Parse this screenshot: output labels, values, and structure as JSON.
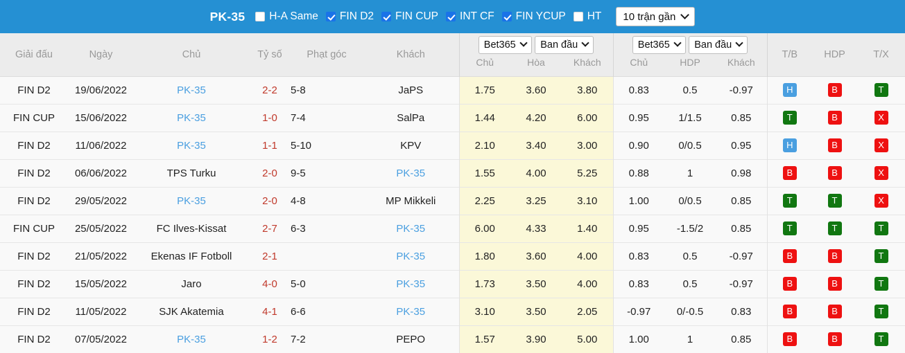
{
  "topbar": {
    "team": "PK-35",
    "filters": [
      {
        "label": "H-A Same",
        "checked": false
      },
      {
        "label": "FIN D2",
        "checked": true
      },
      {
        "label": "FIN CUP",
        "checked": true
      },
      {
        "label": "INT CF",
        "checked": true
      },
      {
        "label": "FIN YCUP",
        "checked": true
      },
      {
        "label": "HT",
        "checked": false
      }
    ],
    "range_select": "10 trận gần",
    "accent_color": "#2590d3",
    "checkbox_on_color": "#1a73e8"
  },
  "table": {
    "headers": {
      "league": "Giải đấu",
      "date": "Ngày",
      "home": "Chủ",
      "score": "Tỷ số",
      "corners": "Phạt góc",
      "away": "Khách",
      "group1_book": "Bet365",
      "group1_type": "Ban đầu",
      "group1_sub": [
        "Chủ",
        "Hòa",
        "Khách"
      ],
      "group2_book": "Bet365",
      "group2_type": "Ban đầu",
      "group2_sub": [
        "Chủ",
        "HDP",
        "Khách"
      ],
      "tb": "T/B",
      "hdp": "HDP",
      "tx": "T/X"
    },
    "rows": [
      {
        "league": "FIN D2",
        "date": "19/06/2022",
        "home": "PK-35",
        "home_hl": true,
        "score": "2-2",
        "corners": "5-8",
        "away": "JaPS",
        "away_hl": false,
        "o1": "1.75",
        "o2": "3.60",
        "o3": "3.80",
        "a1": "0.83",
        "a2": "0.5",
        "a3": "-0.97",
        "tb": "H",
        "hdp": "B",
        "tx": "T"
      },
      {
        "league": "FIN CUP",
        "date": "15/06/2022",
        "home": "PK-35",
        "home_hl": true,
        "score": "1-0",
        "corners": "7-4",
        "away": "SalPa",
        "away_hl": false,
        "o1": "1.44",
        "o2": "4.20",
        "o3": "6.00",
        "a1": "0.95",
        "a2": "1/1.5",
        "a3": "0.85",
        "tb": "T",
        "hdp": "B",
        "tx": "X"
      },
      {
        "league": "FIN D2",
        "date": "11/06/2022",
        "home": "PK-35",
        "home_hl": true,
        "score": "1-1",
        "corners": "5-10",
        "away": "KPV",
        "away_hl": false,
        "o1": "2.10",
        "o2": "3.40",
        "o3": "3.00",
        "a1": "0.90",
        "a2": "0/0.5",
        "a3": "0.95",
        "tb": "H",
        "hdp": "B",
        "tx": "X"
      },
      {
        "league": "FIN D2",
        "date": "06/06/2022",
        "home": "TPS Turku",
        "home_hl": false,
        "score": "2-0",
        "corners": "9-5",
        "away": "PK-35",
        "away_hl": true,
        "o1": "1.55",
        "o2": "4.00",
        "o3": "5.25",
        "a1": "0.88",
        "a2": "1",
        "a3": "0.98",
        "tb": "B",
        "hdp": "B",
        "tx": "X"
      },
      {
        "league": "FIN D2",
        "date": "29/05/2022",
        "home": "PK-35",
        "home_hl": true,
        "score": "2-0",
        "corners": "4-8",
        "away": "MP Mikkeli",
        "away_hl": false,
        "o1": "2.25",
        "o2": "3.25",
        "o3": "3.10",
        "a1": "1.00",
        "a2": "0/0.5",
        "a3": "0.85",
        "tb": "T",
        "hdp": "T",
        "tx": "X"
      },
      {
        "league": "FIN CUP",
        "date": "25/05/2022",
        "home": "FC Ilves-Kissat",
        "home_hl": false,
        "score": "2-7",
        "corners": "6-3",
        "away": "PK-35",
        "away_hl": true,
        "o1": "6.00",
        "o2": "4.33",
        "o3": "1.40",
        "a1": "0.95",
        "a2": "-1.5/2",
        "a3": "0.85",
        "tb": "T",
        "hdp": "T",
        "tx": "T"
      },
      {
        "league": "FIN D2",
        "date": "21/05/2022",
        "home": "Ekenas IF Fotboll",
        "home_hl": false,
        "score": "2-1",
        "corners": "",
        "away": "PK-35",
        "away_hl": true,
        "o1": "1.80",
        "o2": "3.60",
        "o3": "4.00",
        "a1": "0.83",
        "a2": "0.5",
        "a3": "-0.97",
        "tb": "B",
        "hdp": "B",
        "tx": "T"
      },
      {
        "league": "FIN D2",
        "date": "15/05/2022",
        "home": "Jaro",
        "home_hl": false,
        "score": "4-0",
        "corners": "5-0",
        "away": "PK-35",
        "away_hl": true,
        "o1": "1.73",
        "o2": "3.50",
        "o3": "4.00",
        "a1": "0.83",
        "a2": "0.5",
        "a3": "-0.97",
        "tb": "B",
        "hdp": "B",
        "tx": "T"
      },
      {
        "league": "FIN D2",
        "date": "11/05/2022",
        "home": "SJK Akatemia",
        "home_hl": false,
        "score": "4-1",
        "corners": "6-6",
        "away": "PK-35",
        "away_hl": true,
        "o1": "3.10",
        "o2": "3.50",
        "o3": "2.05",
        "a1": "-0.97",
        "a2": "0/-0.5",
        "a3": "0.83",
        "tb": "B",
        "hdp": "B",
        "tx": "T"
      },
      {
        "league": "FIN D2",
        "date": "07/05/2022",
        "home": "PK-35",
        "home_hl": true,
        "score": "1-2",
        "corners": "7-2",
        "away": "PEPO",
        "away_hl": false,
        "o1": "1.57",
        "o2": "3.90",
        "o3": "5.00",
        "a1": "1.00",
        "a2": "1",
        "a3": "0.85",
        "tb": "B",
        "hdp": "B",
        "tx": "T"
      }
    ]
  },
  "colors": {
    "badge_home": "#4a9fe0",
    "badge_over": "#117711",
    "badge_under": "#ee1111",
    "score_text": "#c0392b",
    "team_link": "#4a9fe0",
    "odds_highlight": "#fbf8d8"
  }
}
